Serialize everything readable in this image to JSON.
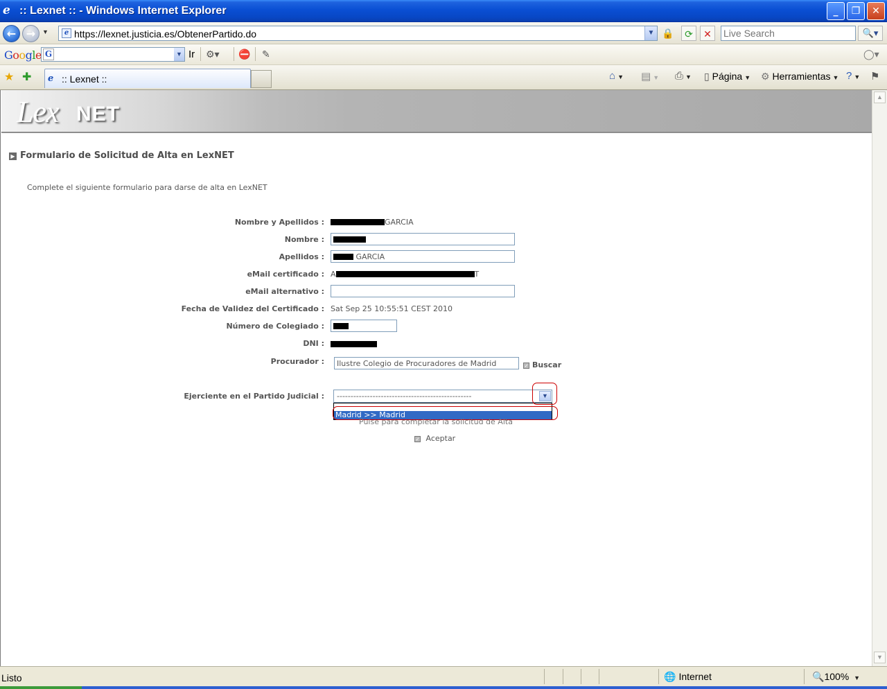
{
  "window": {
    "title": ":: Lexnet :: - Windows Internet Explorer",
    "controls": [
      "minimize",
      "maximize",
      "close"
    ]
  },
  "addressbar": {
    "url": "https://lexnet.justicia.es/ObtenerPartido.do",
    "search_placeholder": "Live Search"
  },
  "google_toolbar": {
    "logo": "Google",
    "go_label": "Ir"
  },
  "tabs": [
    {
      "title": ":: Lexnet ::"
    }
  ],
  "command_bar": {
    "page_label": "Página",
    "tools_label": "Herramientas"
  },
  "banner": {
    "logo_part1": "Lex",
    "logo_part2": "NET"
  },
  "form": {
    "title": "Formulario de Solicitud de Alta en LexNET",
    "intro": "Complete el siguiente formulario para darse de alta en LexNET",
    "fields": {
      "nombre_apellidos": {
        "label": "Nombre y Apellidos :",
        "value_visible": "GARCIA"
      },
      "nombre": {
        "label": "Nombre :"
      },
      "apellidos": {
        "label": "Apellidos :",
        "value_visible": "GARCIA"
      },
      "email_certificado": {
        "label": "eMail certificado :",
        "prefix": "A",
        "suffix": "T"
      },
      "email_alternativo": {
        "label": "eMail alternativo :",
        "value": ""
      },
      "fecha_validez": {
        "label": "Fecha de Validez del Certificado :",
        "value": "Sat Sep 25 10:55:51 CEST 2010"
      },
      "numero_colegiado": {
        "label": "Número de Colegiado :"
      },
      "dni": {
        "label": "DNI :"
      },
      "procurador": {
        "label": "Procurador :",
        "value": "Ilustre Colegio de Procuradores de Madrid",
        "search_label": "Buscar"
      },
      "partido_judicial": {
        "label": "Ejerciente en el Partido Judicial :",
        "selected": "-------------------------------------------------",
        "options": [
          "Madrid >> Madrid"
        ]
      }
    },
    "hint": "Pulse para completar la solicitud de Alta",
    "submit_label": "Aceptar"
  },
  "statusbar": {
    "status": "Listo",
    "zone": "Internet",
    "zoom": "100%"
  },
  "colors": {
    "titlebar": "#0a4fd4",
    "selection": "#316ac5",
    "highlight_ring": "#cc0000"
  }
}
